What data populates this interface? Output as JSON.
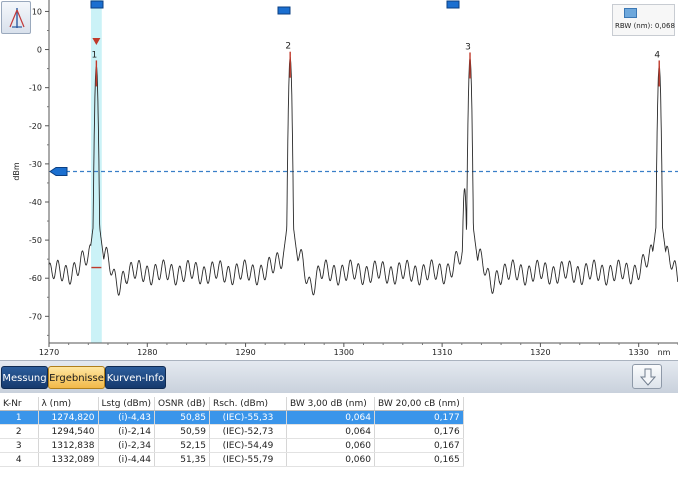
{
  "toolbar": {
    "tool_icon": "peak-marker-icon"
  },
  "plot": {
    "ylabel": "dBm",
    "xunit": "nm",
    "xlim": [
      1270,
      1334
    ],
    "ylim": [
      -77,
      13
    ],
    "yticks": [
      "10",
      "0",
      "-10",
      "-20",
      "-30",
      "-40",
      "-50",
      "-60",
      "-70"
    ],
    "xticks": [
      "1270",
      "1280",
      "1290",
      "1300",
      "1310",
      "1320",
      "1330"
    ],
    "threshold_dbm": -32,
    "rbw_label": "RBW (nm): 0,068",
    "peaks": [
      {
        "label": "1",
        "wavelength": 1274.82,
        "level": -4.43
      },
      {
        "label": "2",
        "wavelength": 1294.54,
        "level": -2.14
      },
      {
        "label": "3",
        "wavelength": 1312.838,
        "level": -2.34
      },
      {
        "label": "4",
        "wavelength": 1332.089,
        "level": -4.44
      }
    ],
    "colors": {
      "trace": "#2a2a2a",
      "threshold": "#3a7fc8",
      "highlight": "#cbf2f7",
      "marker": "#1b6fd0",
      "peak_marker": "#c0392b"
    }
  },
  "tabs": [
    {
      "label": "Messung"
    },
    {
      "label": "Ergebnisse"
    },
    {
      "label": "Kurven-Info"
    }
  ],
  "table": {
    "headers": [
      "K-Nr",
      "λ (nm)",
      "Lstg (dBm)",
      "OSNR (dB)",
      "Rsch. (dBm)",
      "BW 3,00 dB (nm)",
      "BW 20,00 cB (nm)"
    ],
    "rows": [
      [
        "1",
        "1274,820",
        "(i)-4,43",
        "50,85",
        "(IEC)-55,33",
        "0,064",
        "0,177"
      ],
      [
        "2",
        "1294,540",
        "(i)-2,14",
        "50,59",
        "(IEC)-52,73",
        "0,064",
        "0,176"
      ],
      [
        "3",
        "1312,838",
        "(i)-2,34",
        "52,15",
        "(IEC)-54,49",
        "0,060",
        "0,167"
      ],
      [
        "4",
        "1332,089",
        "(i)-4,44",
        "51,35",
        "(IEC)-55,79",
        "0,060",
        "0,165"
      ]
    ]
  }
}
